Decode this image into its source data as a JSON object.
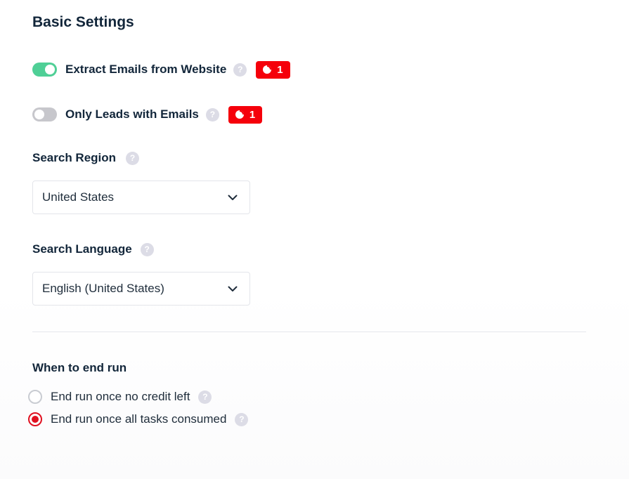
{
  "settings": {
    "title": "Basic Settings",
    "toggles": [
      {
        "label": "Extract Emails from Website",
        "on": true,
        "credit_badge": "1"
      },
      {
        "label": "Only Leads with Emails",
        "on": false,
        "credit_badge": "1"
      }
    ],
    "search_region": {
      "label": "Search Region",
      "value": "United States"
    },
    "search_language": {
      "label": "Search Language",
      "value": "English (United States)"
    },
    "end_run": {
      "label": "When to end run",
      "options": [
        {
          "label": "End run once no credit left",
          "selected": false
        },
        {
          "label": "End run once all tasks consumed",
          "selected": true
        }
      ]
    }
  },
  "icons": {
    "help": "question-mark-icon",
    "badge": "coin-icon",
    "select": "chevron-down-icon"
  },
  "colors": {
    "toggle_on": "#4fcf96",
    "toggle_off": "#c7c7cc",
    "badge": "#f5000b",
    "radio_selected": "#e01020",
    "text": "#12263a"
  },
  "help_glyph": "?"
}
